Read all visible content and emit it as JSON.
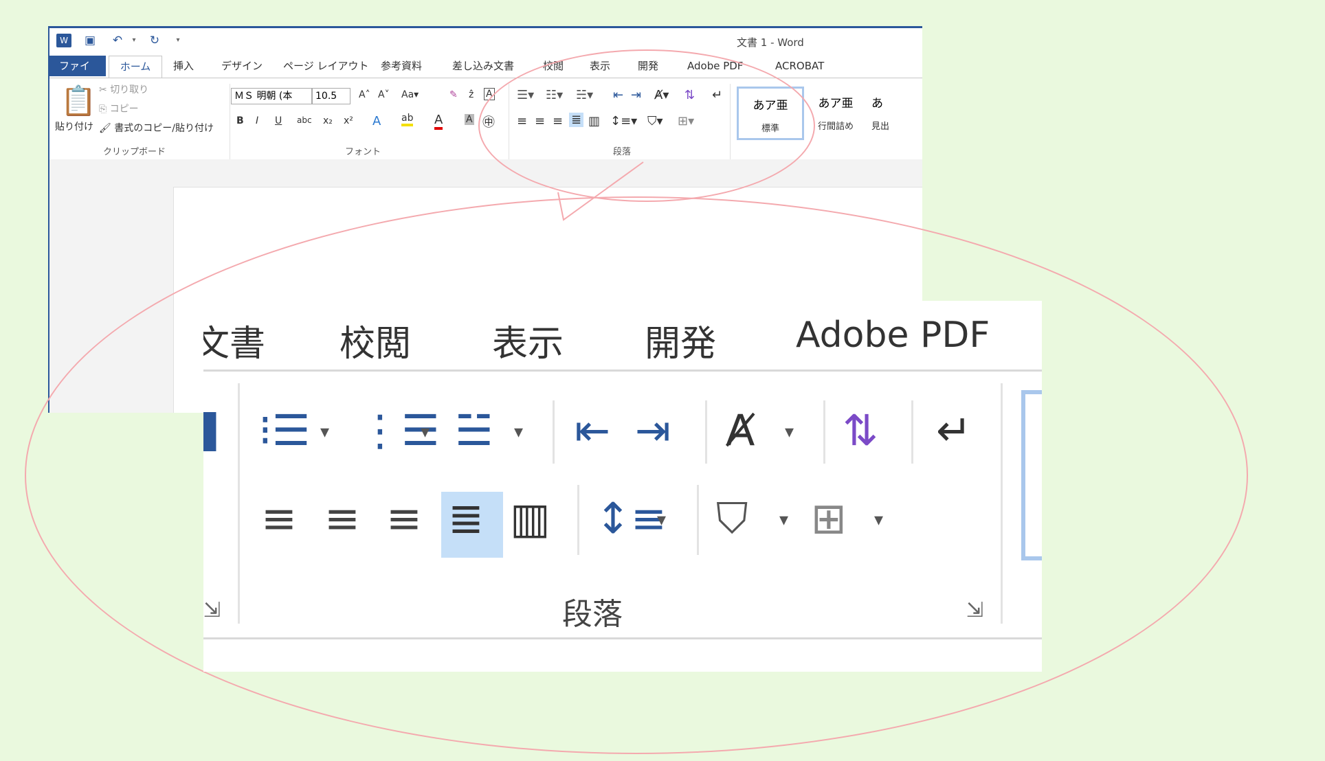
{
  "window": {
    "title": "文書 1 - Word"
  },
  "qat": {
    "word_icon": "W",
    "save_icon": "save-icon",
    "undo_icon": "undo-icon",
    "redo_icon": "redo-icon"
  },
  "tabs": [
    {
      "label": "ファイル"
    },
    {
      "label": "ホーム"
    },
    {
      "label": "挿入"
    },
    {
      "label": "デザイン"
    },
    {
      "label": "ページ レイアウト"
    },
    {
      "label": "参考資料"
    },
    {
      "label": "差し込み文書"
    },
    {
      "label": "校閲"
    },
    {
      "label": "表示"
    },
    {
      "label": "開発"
    },
    {
      "label": "Adobe PDF"
    },
    {
      "label": "ACROBAT"
    }
  ],
  "clipboard": {
    "paste": "貼り付け",
    "cut": "切り取り",
    "copy": "コピー",
    "format_painter": "書式のコピー/貼り付け",
    "group": "クリップボード"
  },
  "font": {
    "name": "ＭＳ 明朝 (本",
    "size": "10.5",
    "group": "フォント"
  },
  "paragraph": {
    "group": "段落"
  },
  "styles": [
    {
      "sample": "あア亜",
      "name": "標準"
    },
    {
      "sample": "あア亜",
      "name": "行間詰め"
    },
    {
      "sample": "あ",
      "name": "見出"
    }
  ],
  "zoom": {
    "tabs": [
      "文書",
      "校閲",
      "表示",
      "開発",
      "Adobe PDF"
    ],
    "group": "段落"
  }
}
